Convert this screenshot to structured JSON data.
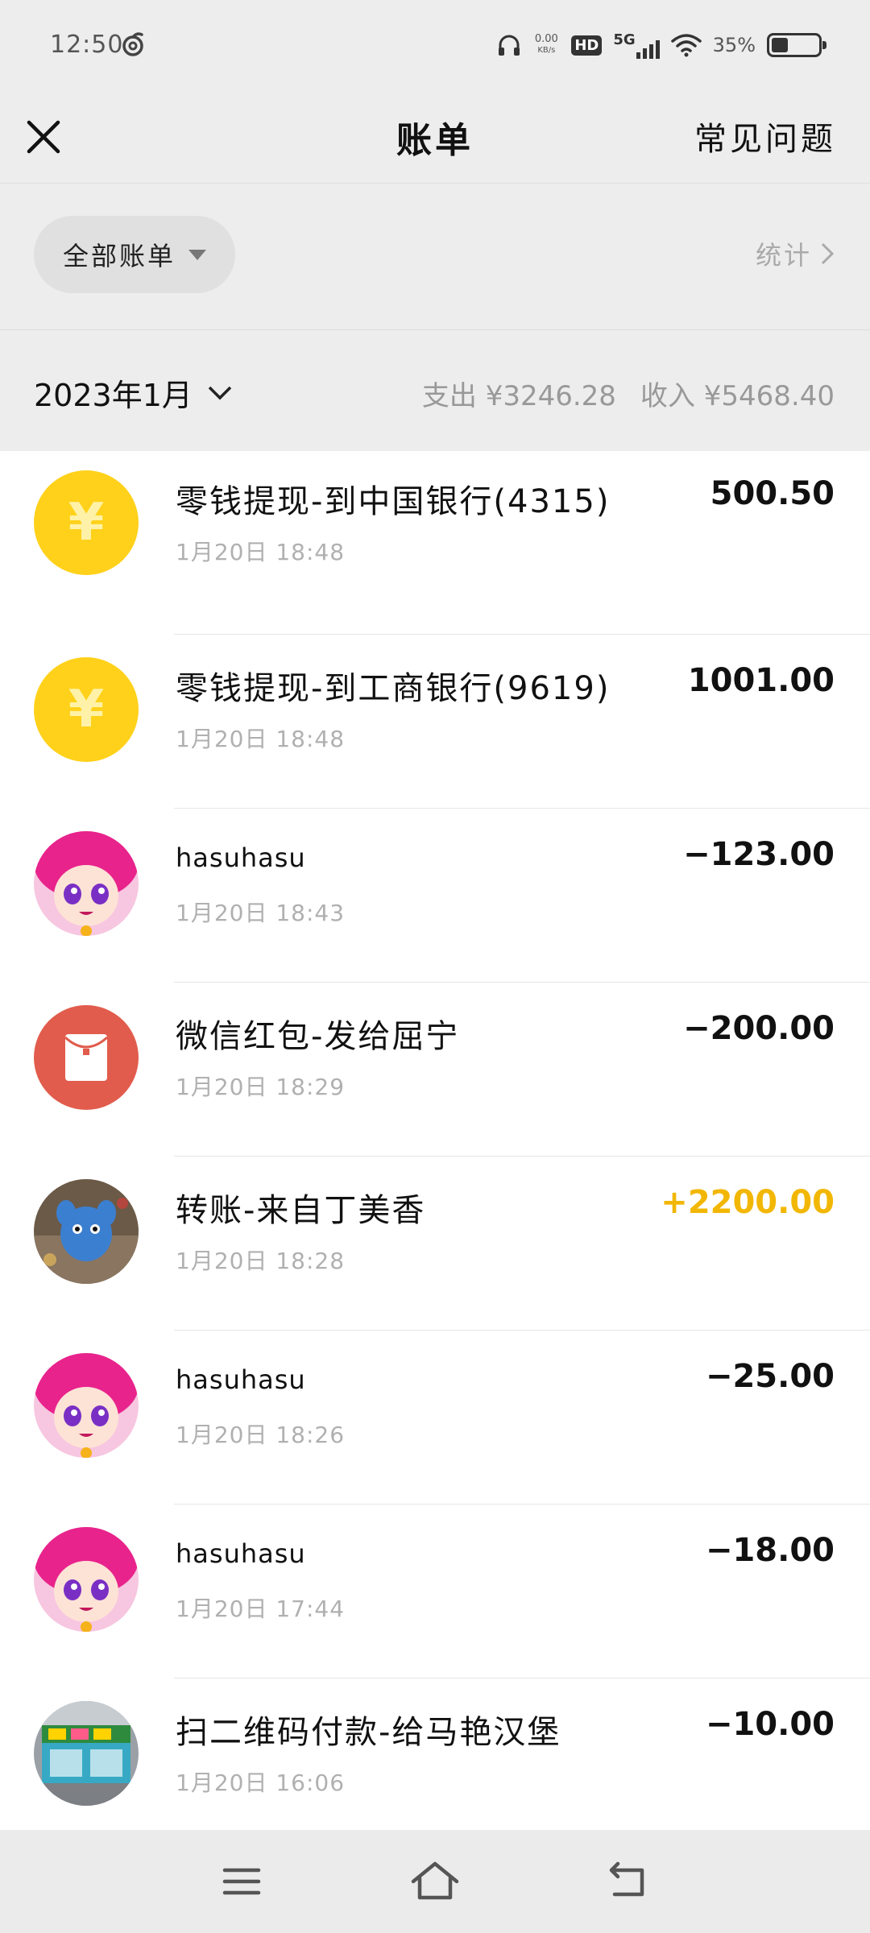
{
  "status_bar": {
    "time": "12:50",
    "net_speed_value": "0.00",
    "net_speed_unit": "KB/s",
    "hd_label": "HD",
    "network": "5G",
    "battery": "35%"
  },
  "header": {
    "title": "账单",
    "faq_label": "常见问题"
  },
  "filter": {
    "label": "全部账单",
    "stats_label": "统计"
  },
  "month_bar": {
    "month": "2023年1月",
    "expense": "支出 ¥3246.28",
    "income": "收入 ¥5468.40"
  },
  "transactions": [
    {
      "title": "零钱提现-到中国银行(4315)",
      "time": "1月20日 18:48",
      "amount": "500.50",
      "icon": "yen-coin-icon",
      "type": "neutral"
    },
    {
      "title": "零钱提现-到工商银行(9619)",
      "time": "1月20日 18:48",
      "amount": "1001.00",
      "icon": "yen-coin-icon",
      "type": "neutral"
    },
    {
      "title": "hasuhasu",
      "time": "1月20日 18:43",
      "amount": "−123.00",
      "icon": "anime-avatar",
      "type": "expense"
    },
    {
      "title": "微信红包-发给屈宁",
      "time": "1月20日 18:29",
      "amount": "−200.00",
      "icon": "red-packet-icon",
      "type": "expense"
    },
    {
      "title": "转账-来自丁美香",
      "time": "1月20日 18:28",
      "amount": "+2200.00",
      "icon": "blue-toy-avatar",
      "type": "income"
    },
    {
      "title": "hasuhasu",
      "time": "1月20日 18:26",
      "amount": "−25.00",
      "icon": "anime-avatar",
      "type": "expense"
    },
    {
      "title": "hasuhasu",
      "time": "1月20日 17:44",
      "amount": "−18.00",
      "icon": "anime-avatar",
      "type": "expense"
    },
    {
      "title": "扫二维码付款-给马艳汉堡",
      "time": "1月20日 16:06",
      "amount": "−10.00",
      "icon": "shop-avatar",
      "type": "expense"
    }
  ],
  "colors": {
    "background_header": "#ededed",
    "income": "#f2b705",
    "coin": "#ffd11a",
    "red_packet": "#e15c4c"
  }
}
